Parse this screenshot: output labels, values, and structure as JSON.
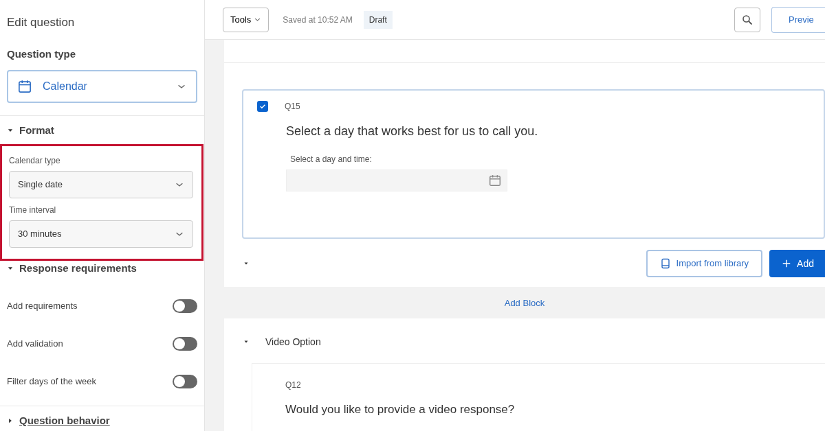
{
  "sidebar": {
    "title": "Edit question",
    "question_type": {
      "label": "Question type",
      "value": "Calendar"
    },
    "sections": [
      {
        "title": "Format",
        "expanded": true,
        "highlighted": true,
        "kind": "selects",
        "fields": [
          {
            "label": "Calendar type",
            "value": "Single date"
          },
          {
            "label": "Time interval",
            "value": "30 minutes"
          }
        ]
      },
      {
        "title": "Response requirements",
        "expanded": true,
        "highlighted": false,
        "kind": "toggles",
        "toggles": [
          {
            "label": "Add requirements",
            "on": false
          },
          {
            "label": "Add validation",
            "on": false
          },
          {
            "label": "Filter days of the week",
            "on": false
          }
        ]
      },
      {
        "title": "Question behavior",
        "expanded": false
      }
    ]
  },
  "toolbar": {
    "tools": "Tools",
    "saved": "Saved at 10:52 AM",
    "status": "Draft",
    "preview": "Previe"
  },
  "block1": {
    "question": {
      "number": "Q15",
      "selected": true,
      "text": "Select a day that works best for us to call you.",
      "field_label": "Select a day and time:"
    },
    "import_button": "Import from library",
    "add_button": "Add"
  },
  "add_block": "Add Block",
  "block2": {
    "title": "Video Option",
    "question": {
      "number": "Q12",
      "text": "Would you like to provide a video response?"
    }
  }
}
